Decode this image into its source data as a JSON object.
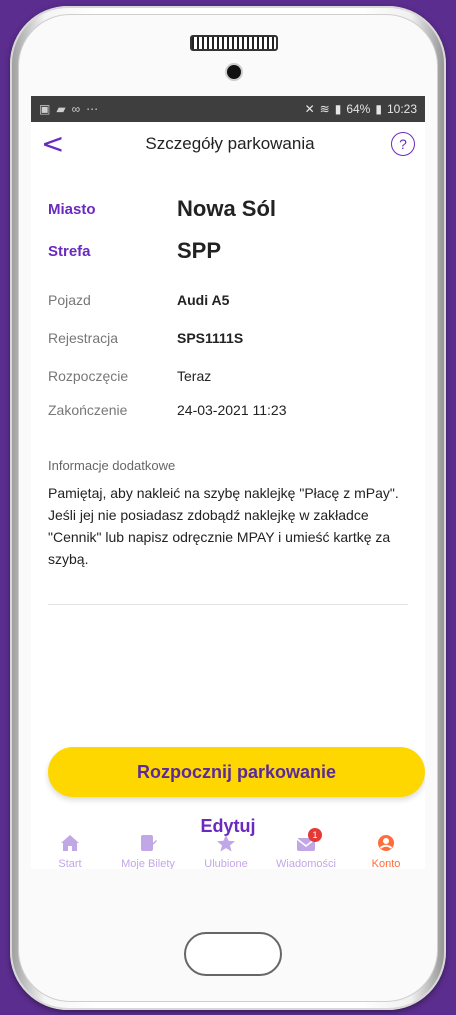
{
  "statusbar": {
    "battery": "64%",
    "time": "10:23"
  },
  "header": {
    "title": "Szczegóły parkowania",
    "back_symbol": "<",
    "help_symbol": "?"
  },
  "details": {
    "miasto_label": "Miasto",
    "miasto_value": "Nowa Sól",
    "strefa_label": "Strefa",
    "strefa_value": "SPP",
    "pojazd_label": "Pojazd",
    "pojazd_value": "Audi A5",
    "rejestracja_label": "Rejestracja",
    "rejestracja_value": "SPS1111S",
    "rozpoczecie_label": "Rozpoczęcie",
    "rozpoczecie_value": "Teraz",
    "zakonczenie_label": "Zakończenie",
    "zakonczenie_value": "24-03-2021 11:23"
  },
  "info": {
    "heading": "Informacje dodatkowe",
    "body": "Pamiętaj, aby nakleić na szybę naklejkę \"Płacę z mPay\". Jeśli jej nie posiadasz zdobądź naklejkę w zakładce \"Cennik\" lub napisz odręcznie MPAY i umieść kartkę za szybą."
  },
  "actions": {
    "start_label": "Rozpocznij parkowanie",
    "edit_label": "Edytuj"
  },
  "bottom_nav": {
    "start": "Start",
    "tickets": "Moje Bilety",
    "favorites": "Ulubione",
    "messages": "Wiadomości",
    "messages_badge": "1",
    "account": "Konto"
  },
  "colors": {
    "accent": "#6a2ac0",
    "primary_button": "#fed700",
    "nav_inactive": "#c2a7e6",
    "badge": "#e53935",
    "account_icon": "#ff6d3a"
  }
}
